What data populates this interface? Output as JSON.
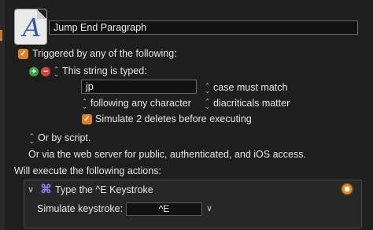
{
  "macro": {
    "name": "Jump End Paragraph"
  },
  "trigger": {
    "header": "Triggered by any of the following:",
    "string_trigger_label": "This string is typed:",
    "typed_string": "jp",
    "case_option": "case must match",
    "following_option": "following any character",
    "diacriticals_option": "diacriticals matter",
    "simulate_deletes_label": "Simulate 2 deletes before executing",
    "or_by_script": "Or by script.",
    "web_server_text": "Or via the web server for public, authenticated, and iOS access."
  },
  "actions": {
    "header": "Will execute the following actions:",
    "items": [
      {
        "title": "Type the ^E Keystroke",
        "simulate_label": "Simulate keystroke:",
        "keystroke": "^E"
      }
    ]
  },
  "icons": {
    "app_icon": "textexpander-a-icon",
    "action_icon": "command-key-icon",
    "gear": "gear-icon"
  },
  "colors": {
    "accent_orange": "#d9822b",
    "add_green": "#3aa640",
    "remove_red": "#d0463b",
    "command_purple": "#8e7cf0"
  }
}
